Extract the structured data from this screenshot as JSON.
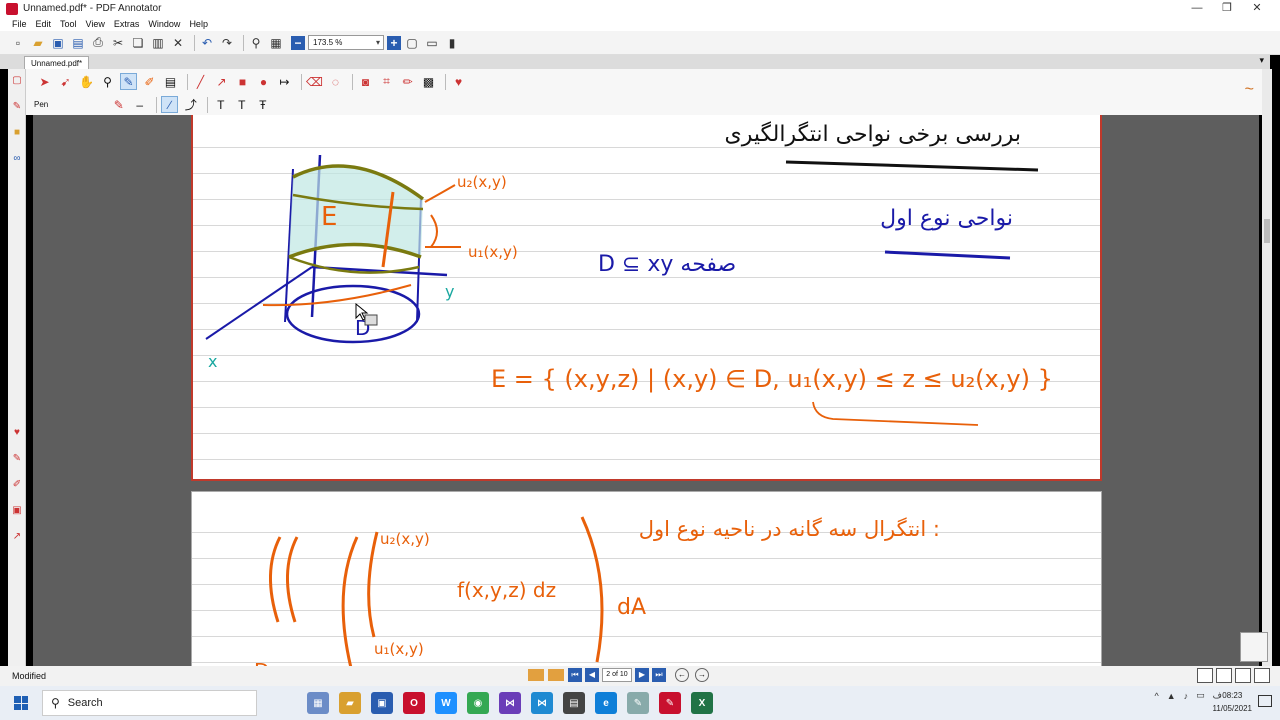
{
  "window": {
    "title": "Unnamed.pdf* - PDF Annotator",
    "controls": [
      "—",
      "❐",
      "✕"
    ]
  },
  "menu": [
    "File",
    "Edit",
    "Tool",
    "View",
    "Extras",
    "Window",
    "Help"
  ],
  "toolbar": {
    "zoom_value": "173.5 %"
  },
  "tabs": {
    "active": "Unnamed.pdf*"
  },
  "pen_toolbar": {
    "label": "Pen"
  },
  "status": {
    "text": "Modified",
    "page_indicator": "2 of 10"
  },
  "page1": {
    "heading": "بررسی برخی نواحی انتگرالگیری",
    "subheading": "نواحی نوع اول",
    "region_note": "D ⊆ xy صفحه",
    "graph_labels": {
      "u2": "u₂(x,y)",
      "u1": "u₁(x,y)",
      "E": "E",
      "D": "D",
      "y": "y",
      "x": "x"
    },
    "set_definition": "E = { (x,y,z) | (x,y) ∈ D,  u₁(x,y) ≤ z ≤ u₂(x,y) }"
  },
  "page2": {
    "heading": "انتگرال سه گانه در ناحیه نوع اول :",
    "integral": {
      "upper": "u₂(x,y)",
      "lower": "u₁(x,y)",
      "integrand": "f(x,y,z) dz",
      "outer": "dA",
      "region": "D"
    }
  },
  "taskbar": {
    "search_placeholder": "Search",
    "time": "08:23",
    "date": "11/05/2021"
  },
  "colors": {
    "ink_orange": "#e8600a",
    "ink_blue": "#1a1aa8",
    "ink_olive": "#7a7a10",
    "ink_teal": "#1aa8a0",
    "ink_black": "#111111",
    "page_border": "#c0392b"
  }
}
